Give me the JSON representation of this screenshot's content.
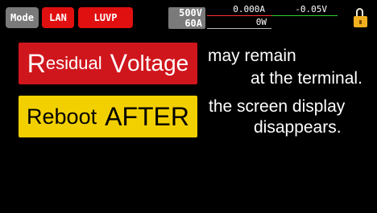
{
  "status_bar": {
    "mode_label": "Mode",
    "lan_label": "LAN",
    "luvp_label": "LUVP",
    "rating": {
      "voltage": "500V",
      "current": "60A"
    },
    "readouts": {
      "current": "0.000A",
      "voltage": "-0.05V",
      "power": "0W"
    },
    "lock_icon": "unlocked-padlock-icon"
  },
  "warning": {
    "red_banner": {
      "word1_first": "R",
      "word1_rest": "esidual",
      "word2_first": "V",
      "word2_rest": "oltage"
    },
    "red_text": [
      "may remain",
      "at the terminal."
    ],
    "yellow_banner": {
      "word1": "Reboot",
      "word2": "AFTER"
    },
    "yellow_text": [
      "the screen display",
      "disappears."
    ]
  },
  "colors": {
    "background": "#000000",
    "mode_button": "#7a7a7a",
    "alert_red": "#d0161d",
    "alert_yellow": "#f2d000",
    "lock": "#f2b01e"
  }
}
